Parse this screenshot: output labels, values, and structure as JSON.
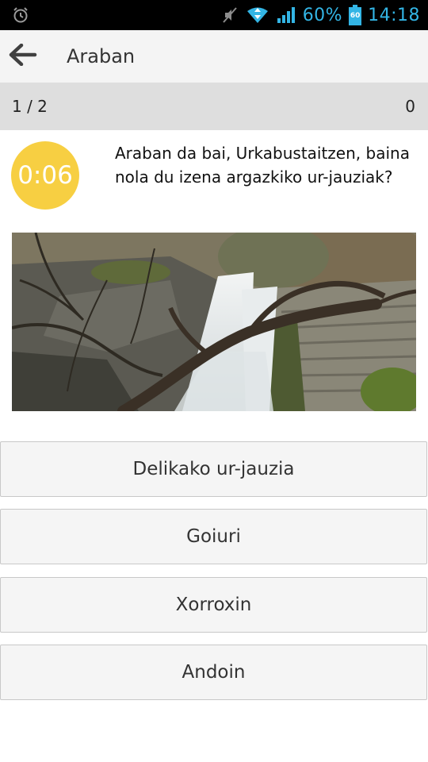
{
  "status_bar": {
    "battery_percent": "60%",
    "battery_level_label": "60",
    "time": "14:18",
    "icons": [
      "alarm-icon",
      "mute-icon",
      "wifi-icon",
      "signal-icon",
      "battery-icon"
    ],
    "color": "#33b5e5"
  },
  "app_bar": {
    "title": "Araban",
    "back_icon": "arrow-left-icon"
  },
  "progress": {
    "counter": "1 / 2",
    "score": "0"
  },
  "quiz": {
    "timer": "0:06",
    "timer_color": "#f7cf42",
    "question": "Araban da bai, Urkabustaitzen, baina nola du izena argazkiko ur-jauziak?",
    "image_subject": "waterfall-photo",
    "answers": [
      {
        "label": "Delikako ur-jauzia"
      },
      {
        "label": "Goiuri"
      },
      {
        "label": "Xorroxin"
      },
      {
        "label": "Andoin"
      }
    ]
  }
}
